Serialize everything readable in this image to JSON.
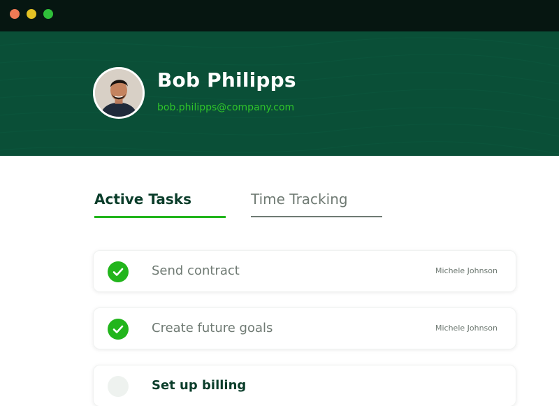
{
  "window": {
    "controls": [
      "close",
      "minimize",
      "maximize"
    ],
    "colors": {
      "close": "#ef7a55",
      "minimize": "#e3c224",
      "maximize": "#2fbf3a"
    }
  },
  "profile": {
    "name": "Bob Philipps",
    "email": "bob.philipps@company.com"
  },
  "tabs": [
    {
      "label": "Active Tasks",
      "active": true
    },
    {
      "label": "Time Tracking",
      "active": false
    }
  ],
  "tasks": [
    {
      "title": "Send contract",
      "assignee": "Michele Johnson",
      "done": true
    },
    {
      "title": "Create future goals",
      "assignee": "Michele Johnson",
      "done": true
    },
    {
      "title": "Set up billing",
      "assignee": "",
      "done": false
    }
  ],
  "colors": {
    "header_bg": "#0a4f37",
    "titlebar_bg": "#061611",
    "accent_green": "#22b51c",
    "email_green": "#2fc42a",
    "dark_text": "#0a3d2a",
    "muted_text": "#6f7a73"
  }
}
